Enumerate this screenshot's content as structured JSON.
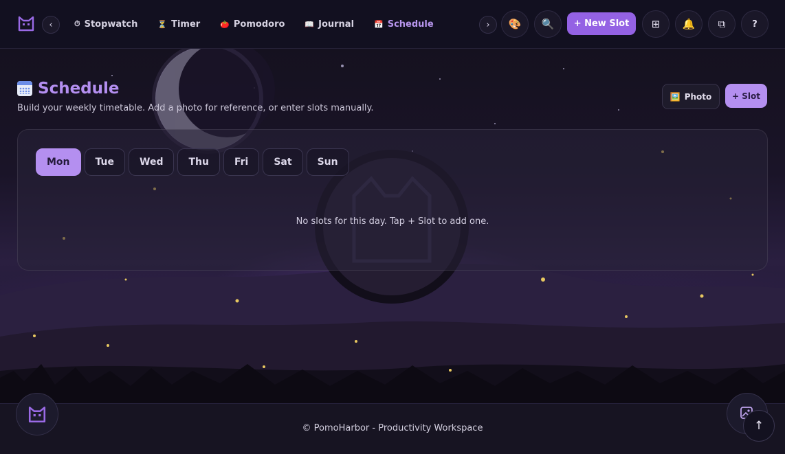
{
  "nav": {
    "tabs": [
      {
        "label": "Stopwatch",
        "icon": "⏱"
      },
      {
        "label": "Timer",
        "icon": "⏳"
      },
      {
        "label": "Pomodoro",
        "icon": "🍅"
      },
      {
        "label": "Journal",
        "icon": "📖"
      },
      {
        "label": "Schedule",
        "icon": "📅"
      }
    ],
    "active_tab": "Schedule",
    "prev_icon": "‹",
    "next_icon": "›",
    "new_slot_label": "+ New Slot",
    "help_label": "?",
    "palette_icon": "🎨",
    "search_icon": "🔍",
    "bell_icon": "🔔",
    "grid_icon": "⊞",
    "window_icon": "⧉"
  },
  "header": {
    "title": "Schedule",
    "subtitle": "Build your weekly timetable. Add a photo for reference, or enter slots manually.",
    "photo_icon": "🖼️",
    "photo_label": "Photo",
    "slot_label": "+ Slot"
  },
  "schedule": {
    "days": [
      "Mon",
      "Tue",
      "Wed",
      "Thu",
      "Fri",
      "Sat",
      "Sun"
    ],
    "selected_day": "Mon",
    "empty_message": "No slots for this day. Tap + Slot to add one."
  },
  "footer": {
    "text": "© PomoHarbor - Productivity Workspace",
    "scroll_top_icon": "↑"
  },
  "colors": {
    "accent": "#b48ff0",
    "primary_button": "#9462e4",
    "background": "#100d1c"
  }
}
